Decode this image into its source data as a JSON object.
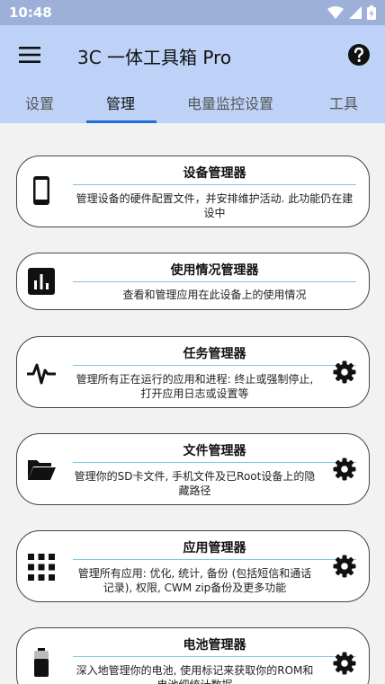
{
  "status_bar": {
    "time": "10:48",
    "icons": [
      "wifi-icon",
      "signal-icon",
      "battery-charging-icon"
    ]
  },
  "app_bar": {
    "title": "3C 一体工具箱 Pro",
    "menu_icon": "hamburger-menu-icon",
    "help_icon": "help-circle-icon"
  },
  "tabs": [
    {
      "label": "设置",
      "active": false
    },
    {
      "label": "管理",
      "active": true
    },
    {
      "label": "电量监控设置",
      "active": false
    },
    {
      "label": "工具",
      "active": false
    }
  ],
  "cards": [
    {
      "title": "设备管理器",
      "desc": "管理设备的硬件配置文件，并安排维护活动. 此功能仍在建设中",
      "icon": "smartphone-icon",
      "has_settings": false
    },
    {
      "title": "使用情况管理器",
      "desc": "查看和管理应用在此设备上的使用情况",
      "icon": "bar-chart-icon",
      "has_settings": false
    },
    {
      "title": "任务管理器",
      "desc": "管理所有正在运行的应用和进程: 终止或强制停止, 打开应用日志或设置等",
      "icon": "pulse-icon",
      "has_settings": true
    },
    {
      "title": "文件管理器",
      "desc": "管理你的SD卡文件, 手机文件及已Root设备上的隐藏路径",
      "icon": "folder-open-icon",
      "has_settings": true
    },
    {
      "title": "应用管理器",
      "desc": "管理所有应用: 优化, 统计, 备份 (包括短信和通话记录), 权限, CWM zip备份及更多功能",
      "icon": "apps-grid-icon",
      "has_settings": true
    },
    {
      "title": "电池管理器",
      "desc": "深入地管理你的电池, 使用标记来获取你的ROM和电池细统计数据",
      "icon": "battery-icon",
      "has_settings": true
    }
  ],
  "colors": {
    "status_bar": "#9db1d8",
    "app_bar": "#bed2f7",
    "tab_indicator": "#1e6fd9",
    "divider": "#7fc7e6",
    "background": "#f2f2f2"
  }
}
